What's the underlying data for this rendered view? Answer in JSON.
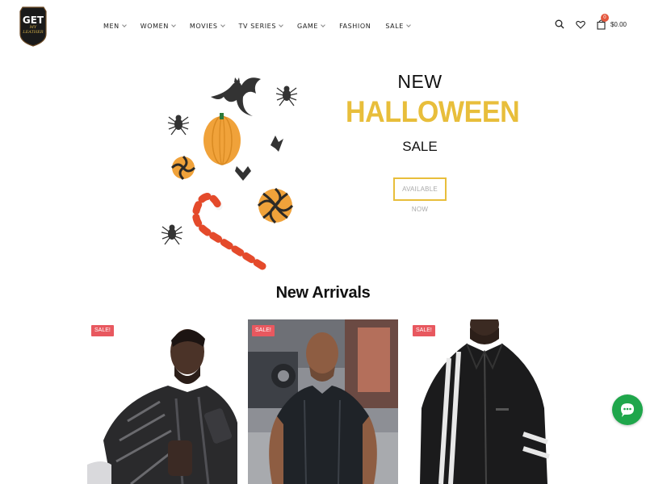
{
  "brand": {
    "line1": "GET",
    "line2": "MY",
    "line3": "LEATHER",
    "colors": {
      "primary": "#1a1a1a",
      "accent": "#d6b14a"
    }
  },
  "nav": {
    "items": [
      {
        "label": "MEN",
        "has_dropdown": true
      },
      {
        "label": "WOMEN",
        "has_dropdown": true
      },
      {
        "label": "MOVIES",
        "has_dropdown": true
      },
      {
        "label": "TV SERIES",
        "has_dropdown": true
      },
      {
        "label": "GAME",
        "has_dropdown": true
      },
      {
        "label": "FASHION",
        "has_dropdown": false
      },
      {
        "label": "SALE",
        "has_dropdown": true
      }
    ]
  },
  "tools": {
    "search_icon": "search-icon",
    "wishlist_icon": "heart-icon",
    "cart_icon": "shopping-bag-icon",
    "cart_count": "0",
    "cart_total": "$0.00"
  },
  "hero": {
    "line1": "NEW",
    "line2": "HALLOWEEN",
    "line3": "SALE",
    "button_label": "AVAILABLE NOW",
    "colors": {
      "highlight": "#e8be3b"
    }
  },
  "new_arrivals": {
    "title": "New Arrivals",
    "products": [
      {
        "badge": "SALE!"
      },
      {
        "badge": "SALE!"
      },
      {
        "badge": "SALE!"
      }
    ],
    "colors": {
      "badge": "#e8585f"
    }
  },
  "chat": {
    "icon": "chat-bubble-icon",
    "color": "#1fa64b"
  }
}
